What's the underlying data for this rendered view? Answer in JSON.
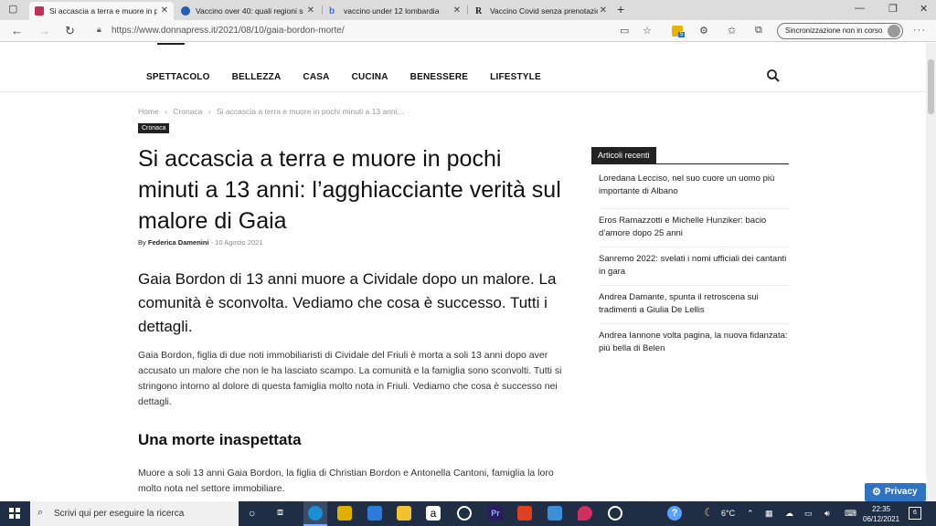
{
  "browser": {
    "tabs": [
      {
        "title": "Si accascia a terra e muore in po",
        "active": true,
        "favicon_color": "#c0305a"
      },
      {
        "title": "Vaccino over 40: quali regioni so",
        "active": false,
        "favicon_color": "#1f5fb4"
      },
      {
        "title": "vaccino under 12 lombardia",
        "active": false,
        "favicon_color": "#2a7ae2"
      },
      {
        "title": "Vaccino Covid senza prenotazion",
        "active": false,
        "favicon_color": "#222222"
      }
    ],
    "url": "https://www.donnapress.it/2021/08/10/gaia-bordon-morte/",
    "sync_label": "Sincronizzazione non in corso",
    "extension_badge": "5"
  },
  "site": {
    "menu": [
      "SPETTACOLO",
      "BELLEZZA",
      "CASA",
      "CUCINA",
      "BENESSERE",
      "LIFESTYLE"
    ]
  },
  "article": {
    "breadcrumbs": [
      "Home",
      "›",
      "Cronaca",
      "›",
      "Si accascia a terra e muore in pochi minuti a 13 anni..."
    ],
    "category": "Cronaca",
    "title": "Si accascia a terra e muore in pochi minuti a 13 anni: l’agghiacciante verità sul malore di Gaia",
    "by_label": "By",
    "author": "Federica Damenini",
    "separator": "-",
    "date": "10 Agosto 2021",
    "lead": "Gaia Bordon di 13 anni muore a Cividale dopo un malore. La comunità è sconvolta. Vediamo che cosa è successo. Tutti i dettagli.",
    "paragraph1": "Gaia Bordon, figlia di due noti immobiliaristi di Cividale del Friuli è morta a soli 13 anni dopo aver accusato un malore che non le ha lasciato scampo. La comunità e la famiglia sono sconvolti. Tutti si stringono intorno al dolore di questa famiglia molto nota in Friuli. Vediamo che cosa è successo nei dettagli.",
    "subheading": "Una morte inaspettata",
    "paragraph2": "Muore a soli 13 anni Gaia Bordon, la figlia di Christian Bordon e Antonella Cantoni, famiglia la loro molto nota nel settore immobiliare."
  },
  "sidebar": {
    "title": "Articoli recenti",
    "items": [
      "Loredana Lecciso, nel suo cuore un uomo più importante di Albano",
      "Eros Ramazzotti e Michelle Hunziker: bacio d’amore dopo 25 anni",
      "Sanremo 2022: svelati i nomi ufficiali dei cantanti in gara",
      "Andrea Damante, spunta il retroscena sui tradimenti a Giulia De Lellis",
      "Andrea Iannone volta pagina, la nuova fidanzata: più bella di Belen"
    ]
  },
  "privacy_label": "Privacy",
  "taskbar": {
    "search_placeholder": "Scrivi qui per eseguire la ricerca",
    "temperature": "6°C",
    "time": "22:35",
    "date": "06/12/2021",
    "notifications": "6"
  }
}
